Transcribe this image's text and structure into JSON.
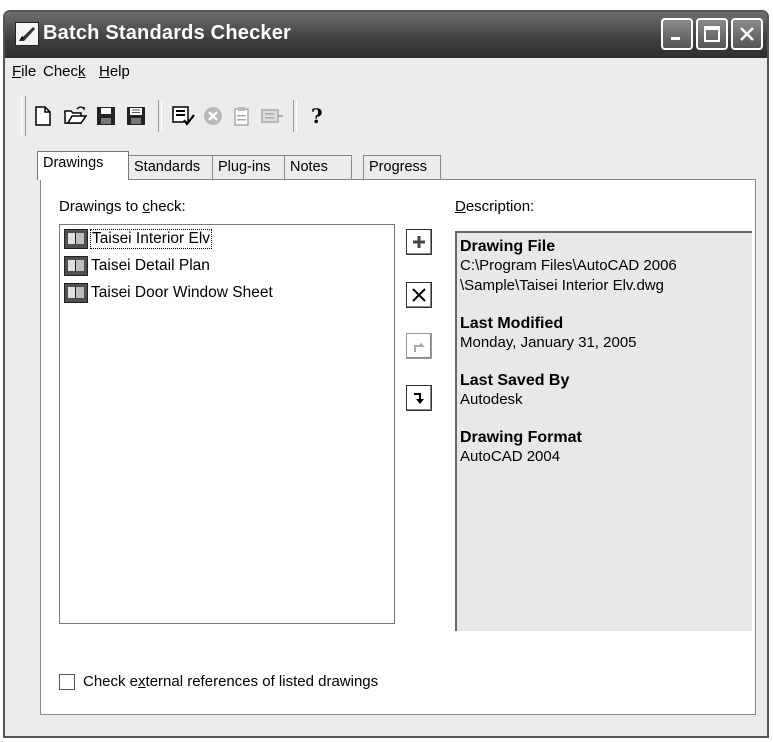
{
  "window": {
    "title": "Batch Standards Checker"
  },
  "menu": [
    {
      "pre": "",
      "u": "F",
      "post": "ile"
    },
    {
      "pre": "Chec",
      "u": "k",
      "post": ""
    },
    {
      "pre": "",
      "u": "H",
      "post": "elp"
    }
  ],
  "toolbar_icons": [
    "new-icon",
    "open-icon",
    "save-icon",
    "save-as-icon",
    "check-icon",
    "stop-icon",
    "copy-report-icon",
    "export-report-icon",
    "help-icon"
  ],
  "tabs": [
    "Drawings",
    "Standards",
    "Plug-ins",
    "Notes",
    "Progress"
  ],
  "drawings": {
    "label_pre": "Drawings to ",
    "label_u": "c",
    "label_post": "heck:",
    "items": [
      "Taisei Interior Elv",
      "Taisei Detail Plan",
      "Taisei Door Window Sheet"
    ]
  },
  "description": {
    "label_u": "D",
    "label_post": "escription:",
    "drawing_file_h": "Drawing File",
    "drawing_file_line1": "C:\\Program Files\\AutoCAD 2006",
    "drawing_file_line2": "\\Sample\\Taisei Interior Elv.dwg",
    "last_modified_h": "Last Modified",
    "last_modified_v": "Monday, January 31, 2005",
    "last_saved_h": "Last Saved By",
    "last_saved_v": "Autodesk",
    "format_h": "Drawing Format",
    "format_v": "AutoCAD 2004"
  },
  "xref": {
    "pre": "Check e",
    "u": "x",
    "post": "ternal references of listed drawings",
    "checked": false
  }
}
